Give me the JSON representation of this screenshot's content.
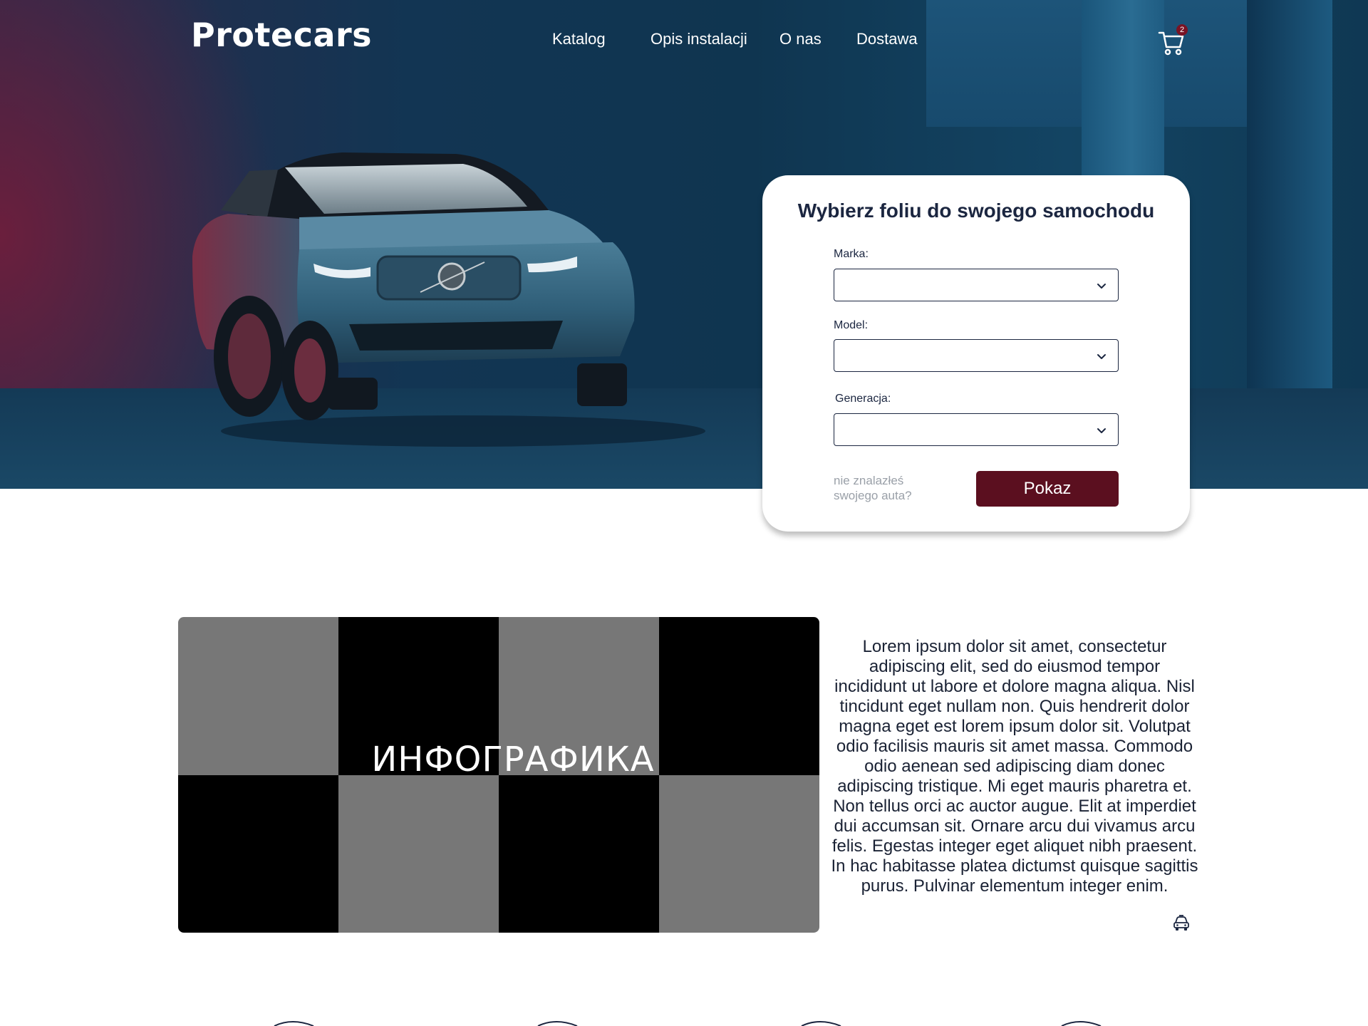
{
  "brand": {
    "logo": "Protecars"
  },
  "nav": {
    "items": [
      {
        "label": "Katalog"
      },
      {
        "label": "Opis instalacji"
      },
      {
        "label": "O nas"
      },
      {
        "label": "Dostawa"
      }
    ],
    "cart": {
      "icon": "cart-icon",
      "count": "2"
    }
  },
  "hero": {
    "image": "car-photo"
  },
  "form": {
    "title": "Wybierz foliu do swojego samochodu",
    "fields": [
      {
        "label": "Marka:",
        "value": ""
      },
      {
        "label": "Model:",
        "value": ""
      },
      {
        "label": "Generacja:",
        "value": ""
      }
    ],
    "hint_line1": "nie znalazłeś",
    "hint_line2": "swojego auta?",
    "submit_label": "Pokaz"
  },
  "infographic": {
    "label": "ИНФОГРАФИКА"
  },
  "content": {
    "paragraph": "Lorem ipsum dolor sit amet, consectetur adipiscing elit, sed do eiusmod tempor incididunt ut labore et dolore magna aliqua. Nisl tincidunt eget nullam non. Quis hendrerit dolor magna eget est lorem ipsum dolor sit. Volutpat odio facilisis mauris sit amet massa. Commodo odio aenean sed adipiscing diam donec adipiscing tristique. Mi eget mauris pharetra et. Non tellus orci ac auctor augue. Elit at imperdiet dui accumsan sit. Ornare arcu dui vivamus arcu felis. Egestas integer eget aliquet nibh praesent. In hac habitasse platea dictumst quisque sagittis purus. Pulvinar elementum integer enim.",
    "icon": "car-icon"
  },
  "colors": {
    "accent": "#5b0f1f",
    "badge": "#7a1324",
    "text": "#1b2640"
  }
}
